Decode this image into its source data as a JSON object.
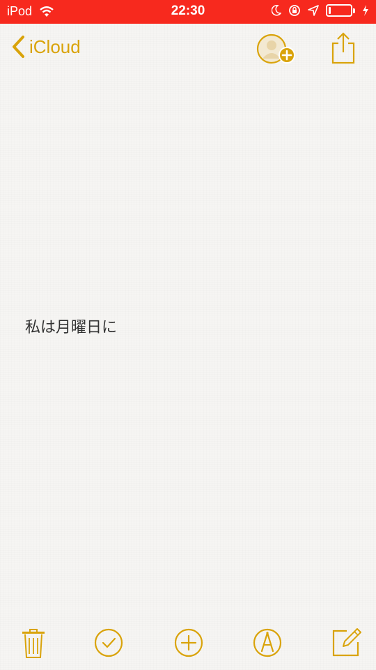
{
  "status_bar": {
    "device": "iPod",
    "time": "22:30",
    "battery_level": 0.1,
    "background_color": "#f7291e",
    "icons": [
      "wifi-icon",
      "moon-icon",
      "rotation-lock-icon",
      "location-icon",
      "battery-icon",
      "charging-icon"
    ]
  },
  "nav": {
    "back_label": "iCloud",
    "accent_color": "#d9a30a",
    "icons": [
      "chevron-left-icon",
      "add-person-icon",
      "share-icon"
    ]
  },
  "note": {
    "text": "私は月曜日に"
  },
  "toolbar": {
    "icons": [
      "trash-icon",
      "checklist-icon",
      "add-icon",
      "markup-pen-icon",
      "compose-icon"
    ]
  }
}
